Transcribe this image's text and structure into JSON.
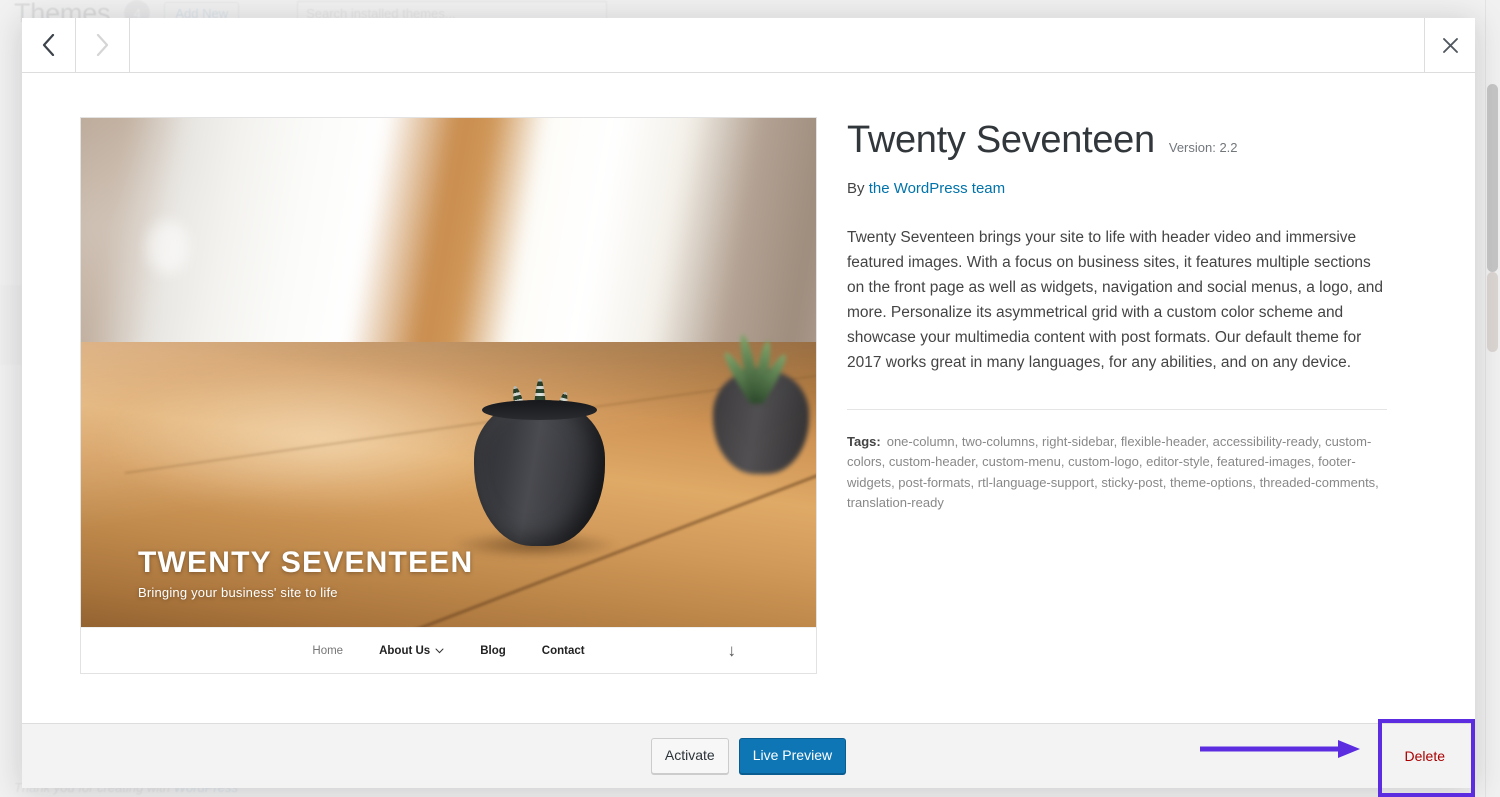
{
  "background_page": {
    "title": "Themes",
    "theme_count": "4",
    "add_new_label": "Add New",
    "search_placeholder": "Search installed themes...",
    "footer_text": "Thank you for creating with ",
    "footer_link": "WordPress"
  },
  "modal": {
    "nav": {
      "previous_label": "‹",
      "next_label": "›",
      "close_label": "✕"
    },
    "screenshot": {
      "caption_title": "TWENTY SEVENTEEN",
      "caption_tagline": "Bringing your business' site to life",
      "nav_items": [
        {
          "label": "Home",
          "has_dropdown": false,
          "muted": true
        },
        {
          "label": "About Us",
          "has_dropdown": true,
          "muted": false
        },
        {
          "label": "Blog",
          "has_dropdown": false,
          "muted": false
        },
        {
          "label": "Contact",
          "has_dropdown": false,
          "muted": false
        }
      ],
      "scroll_down_icon": "↓"
    },
    "theme": {
      "name": "Twenty Seventeen",
      "version": "Version: 2.2",
      "author_prefix": "By ",
      "author": "the WordPress team",
      "description": "Twenty Seventeen brings your site to life with header video and immersive featured images. With a focus on business sites, it features multiple sections on the front page as well as widgets, navigation and social menus, a logo, and more. Personalize its asymmetrical grid with a custom color scheme and showcase your multimedia content with post formats. Our default theme for 2017 works great in many languages, for any abilities, and on any device.",
      "tags_label": "Tags:",
      "tags": "one-column, two-columns, right-sidebar, flexible-header, accessibility-ready, custom-colors, custom-header, custom-menu, custom-logo, editor-style, featured-images, footer-widgets, post-formats, rtl-language-support, sticky-post, theme-options, threaded-comments, translation-ready"
    },
    "footer": {
      "activate_label": "Activate",
      "live_preview_label": "Live Preview",
      "delete_label": "Delete"
    }
  },
  "annotation": {
    "highlight_color": "#5b2ce0",
    "arrow_color": "#5b2ce0",
    "target": "Delete"
  },
  "colors": {
    "primary_button": "#0e76b5",
    "link": "#0073aa",
    "delete_link": "#a00",
    "footer_bg": "#f3f3f3"
  }
}
